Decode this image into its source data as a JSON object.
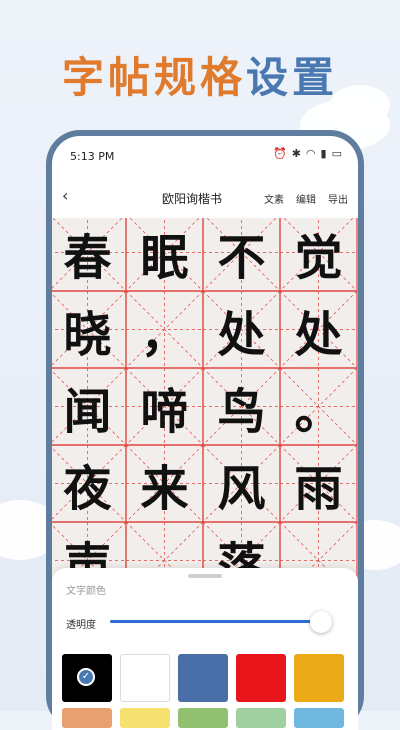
{
  "banner": {
    "part1": "字帖",
    "part2": "规格",
    "part3": "设置"
  },
  "status": {
    "time": "5:13 PM",
    "icons": [
      "alarm-icon",
      "bluetooth-icon",
      "wifi-icon",
      "signal-icon",
      "battery-icon"
    ]
  },
  "nav": {
    "title": "欧阳询楷书",
    "actions": [
      "文素",
      "编辑",
      "导出"
    ]
  },
  "characters": [
    "春",
    "眠",
    "不",
    "觉",
    "晓",
    "，",
    "处",
    "处",
    "闻",
    "啼",
    "鸟",
    "。",
    "夜",
    "来",
    "风",
    "雨",
    "声",
    "",
    "落",
    ""
  ],
  "panel": {
    "title": "文字颜色",
    "opacity_label": "透明度",
    "opacity_value": 0.95
  },
  "colors": {
    "grid_line": "#e0403c",
    "swatches": [
      "#000000",
      "#ffffff",
      "#4a6fa8",
      "#e8161b",
      "#ebaa18"
    ],
    "swatches_row2": [
      "#e8a070",
      "#f5e070",
      "#90c070",
      "#a0d0a0",
      "#70b8e0"
    ],
    "selected_swatch": 0
  }
}
